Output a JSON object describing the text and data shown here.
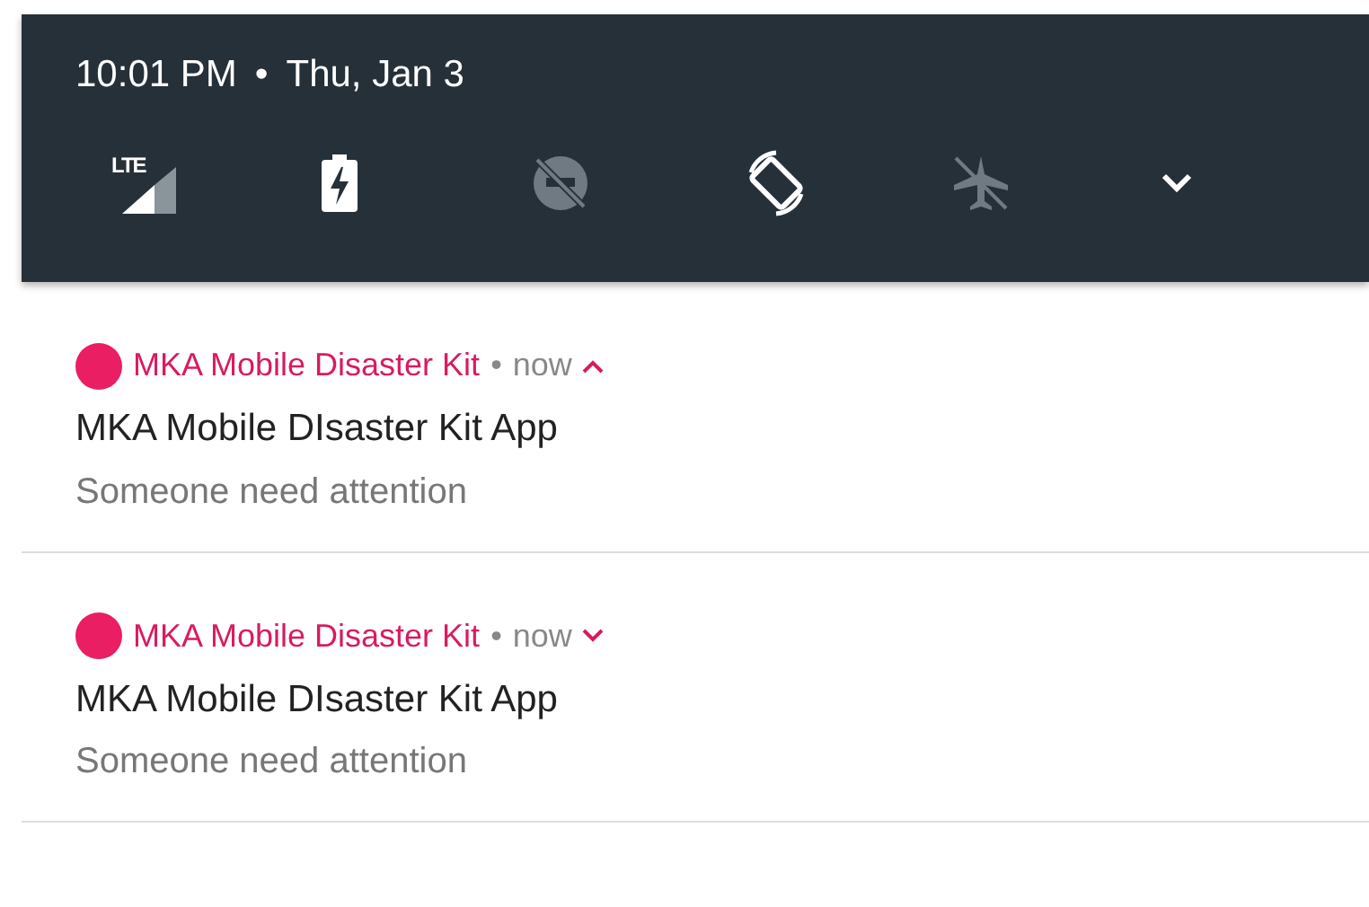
{
  "status": {
    "time": "10:01 PM",
    "separator": "•",
    "date": "Thu, Jan 3"
  },
  "quick_settings": [
    {
      "kind": "cellular",
      "label": "LTE",
      "on": true
    },
    {
      "kind": "battery",
      "on": true
    },
    {
      "kind": "dnd",
      "on": false
    },
    {
      "kind": "rotate",
      "on": true
    },
    {
      "kind": "airplane",
      "on": false
    }
  ],
  "panel": {
    "expanded": false
  },
  "notifications": [
    {
      "app": "MKA Mobile Disaster Kit",
      "separator": "•",
      "time": "now",
      "expanded": true,
      "title": "MKA Mobile DIsaster Kit App",
      "text": "Someone need attention"
    },
    {
      "app": "MKA Mobile Disaster Kit",
      "separator": "•",
      "time": "now",
      "expanded": false,
      "title": "MKA Mobile DIsaster Kit App",
      "text": "Someone need attention"
    }
  ]
}
